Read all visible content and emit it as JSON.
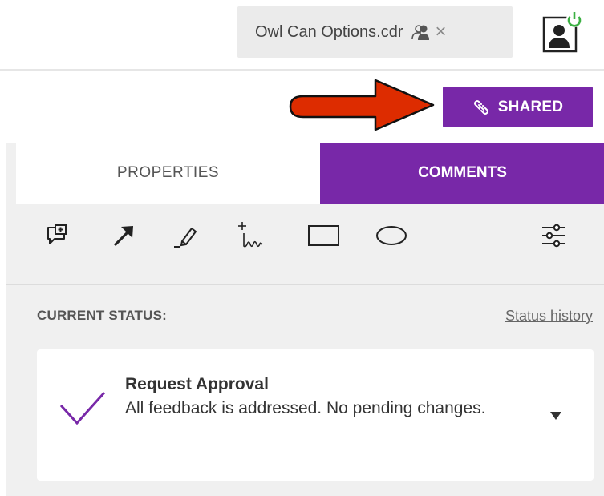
{
  "file_tab": {
    "name": "Owl Can Options.cdr",
    "shared_icon": "shared-doc-icon",
    "close_glyph": "×"
  },
  "user_status_icon": "user-online-icon",
  "share": {
    "label": "SHARED",
    "icon": "link-icon",
    "annotation": "red-arrow-annotation"
  },
  "tabs": [
    {
      "label": "PROPERTIES",
      "active": false
    },
    {
      "label": "COMMENTS",
      "active": true
    }
  ],
  "toolbar": {
    "tools": [
      "add-comment-icon",
      "arrow-icon",
      "highlighter-icon",
      "freehand-draw-icon",
      "rectangle-icon",
      "ellipse-icon",
      "filter-settings-icon"
    ]
  },
  "status": {
    "label": "CURRENT STATUS:",
    "history_link": "Status history",
    "title": "Request Approval",
    "description": "All feedback is addressed. No pending changes."
  },
  "colors": {
    "accent": "#7828a8",
    "annotation_red": "#dd2c00",
    "panel_bg": "#f0f0f0"
  }
}
